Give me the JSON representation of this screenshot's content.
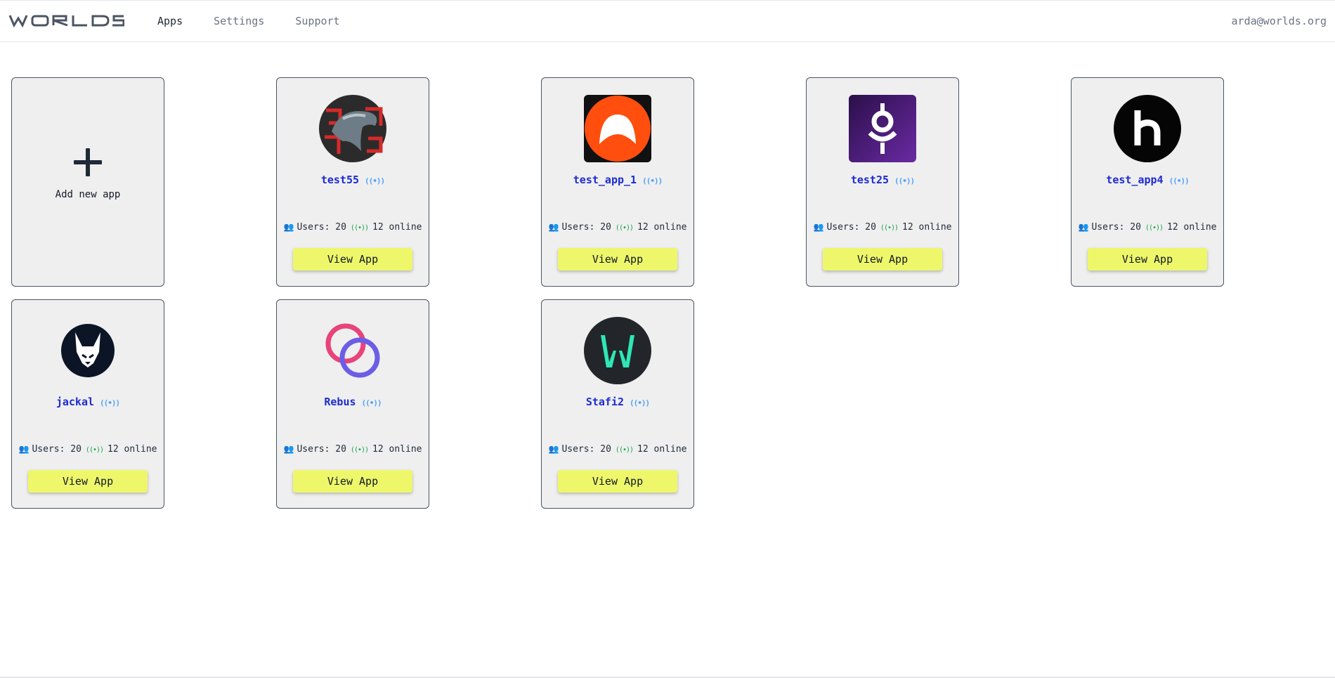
{
  "header": {
    "logo_text": "WORLDS",
    "nav": [
      {
        "label": "Apps",
        "active": true
      },
      {
        "label": "Settings",
        "active": false
      },
      {
        "label": "Support",
        "active": false
      }
    ],
    "user_email": "arda@worlds.org"
  },
  "add_card": {
    "label": "Add new app",
    "icon": "plus-icon"
  },
  "apps": [
    {
      "name": "test55",
      "users_label": "Users: 20",
      "online_label": "12 online",
      "button": "View App",
      "logo": "shark-logo",
      "live_glyph": "((•))"
    },
    {
      "name": "test_app_1",
      "users_label": "Users: 20",
      "online_label": "12 online",
      "button": "View App",
      "logo": "orange-arch-logo",
      "live_glyph": "((•))"
    },
    {
      "name": "test25",
      "users_label": "Users: 20",
      "online_label": "12 online",
      "button": "View App",
      "logo": "purple-ring-logo",
      "live_glyph": "((•))"
    },
    {
      "name": "test_app4",
      "users_label": "Users: 20",
      "online_label": "12 online",
      "button": "View App",
      "logo": "black-h-logo",
      "live_glyph": "((•))"
    },
    {
      "name": "jackal",
      "users_label": "Users: 20",
      "online_label": "12 online",
      "button": "View App",
      "logo": "jackal-logo",
      "live_glyph": "((•))"
    },
    {
      "name": "Rebus",
      "users_label": "Users: 20",
      "online_label": "12 online",
      "button": "View App",
      "logo": "rebus-rings-logo",
      "live_glyph": "((•))"
    },
    {
      "name": "Stafi2",
      "users_label": "Users: 20",
      "online_label": "12 online",
      "button": "View App",
      "logo": "w-logo",
      "live_glyph": "((•))"
    }
  ],
  "colors": {
    "button_bg": "#eef76a",
    "app_name": "#1d2bd1",
    "card_bg": "#efefef",
    "online": "#16a34a"
  }
}
